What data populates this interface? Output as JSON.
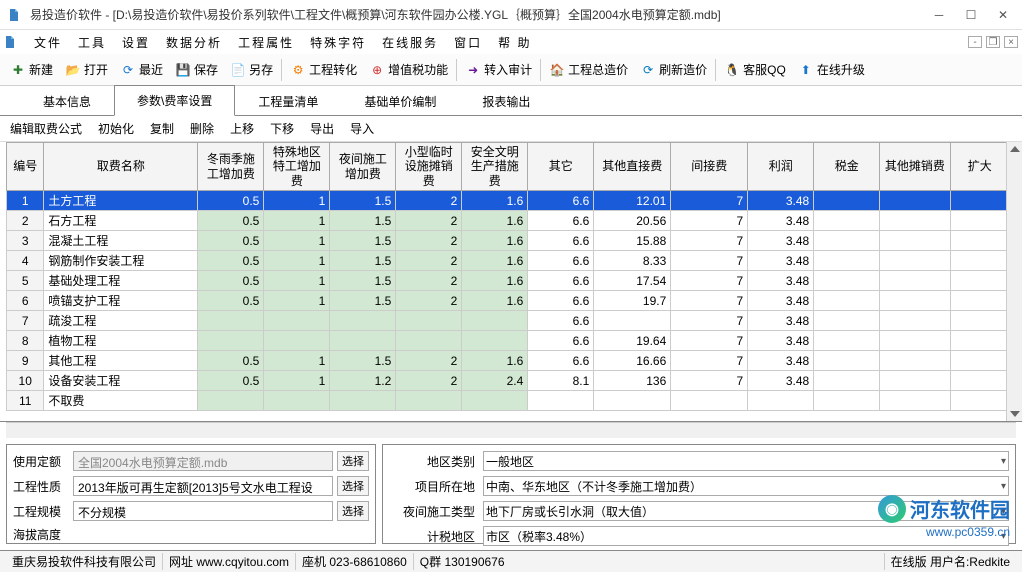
{
  "window": {
    "title": "易投造价软件 - [D:\\易投造价软件\\易投价系列软件\\工程文件\\概预算\\河东软件园办公楼.YGL｛概预算｝全国2004水电预算定额.mdb]"
  },
  "menu": [
    "文件",
    "工具",
    "设置",
    "数据分析",
    "工程属性",
    "特殊字符",
    "在线服务",
    "窗口",
    "帮 助"
  ],
  "toolbar": [
    {
      "icon": "new",
      "label": "新建"
    },
    {
      "icon": "open",
      "label": "打开"
    },
    {
      "icon": "recent",
      "label": "最近"
    },
    {
      "icon": "save",
      "label": "保存"
    },
    {
      "icon": "saveas",
      "label": "另存"
    },
    {
      "sep": true
    },
    {
      "icon": "convert",
      "label": "工程转化"
    },
    {
      "icon": "vat",
      "label": "增值税功能"
    },
    {
      "sep": true
    },
    {
      "icon": "audit",
      "label": "转入审计"
    },
    {
      "sep": true
    },
    {
      "icon": "total",
      "label": "工程总造价"
    },
    {
      "icon": "refresh",
      "label": "刷新造价"
    },
    {
      "sep": true
    },
    {
      "icon": "qq",
      "label": "客服QQ"
    },
    {
      "icon": "upgrade",
      "label": "在线升级"
    }
  ],
  "tabs": [
    "基本信息",
    "参数\\费率设置",
    "工程量清单",
    "基础单价编制",
    "报表输出"
  ],
  "activeTab": 1,
  "subToolbar": [
    "编辑取费公式",
    "初始化",
    "复制",
    "删除",
    "上移",
    "下移",
    "导出",
    "导入"
  ],
  "columns": [
    "编号",
    "取费名称",
    "冬雨季施工增加费",
    "特殊地区特工增加费",
    "夜间施工增加费",
    "小型临时设施摊销费",
    "安全文明生产措施费",
    "其它",
    "其他直接费",
    "间接费",
    "利润",
    "税金",
    "其他摊销费",
    "扩大"
  ],
  "rows": [
    {
      "idx": "1",
      "name": "土方工程",
      "c": [
        "0.5",
        "1",
        "1.5",
        "2",
        "1.6",
        "6.6",
        "12.01",
        "7",
        "3.48",
        "",
        ""
      ],
      "sel": true
    },
    {
      "idx": "2",
      "name": "石方工程",
      "c": [
        "0.5",
        "1",
        "1.5",
        "2",
        "1.6",
        "6.6",
        "20.56",
        "7",
        "3.48",
        "",
        ""
      ]
    },
    {
      "idx": "3",
      "name": "混凝土工程",
      "c": [
        "0.5",
        "1",
        "1.5",
        "2",
        "1.6",
        "6.6",
        "15.88",
        "7",
        "3.48",
        "",
        ""
      ]
    },
    {
      "idx": "4",
      "name": "钢筋制作安装工程",
      "c": [
        "0.5",
        "1",
        "1.5",
        "2",
        "1.6",
        "6.6",
        "8.33",
        "7",
        "3.48",
        "",
        ""
      ]
    },
    {
      "idx": "5",
      "name": "基础处理工程",
      "c": [
        "0.5",
        "1",
        "1.5",
        "2",
        "1.6",
        "6.6",
        "17.54",
        "7",
        "3.48",
        "",
        ""
      ]
    },
    {
      "idx": "6",
      "name": "喷锚支护工程",
      "c": [
        "0.5",
        "1",
        "1.5",
        "2",
        "1.6",
        "6.6",
        "19.7",
        "7",
        "3.48",
        "",
        ""
      ]
    },
    {
      "idx": "7",
      "name": "疏浚工程",
      "c": [
        "",
        "",
        "",
        "",
        "",
        "6.6",
        "",
        "7",
        "3.48",
        "",
        ""
      ]
    },
    {
      "idx": "8",
      "name": "植物工程",
      "c": [
        "",
        "",
        "",
        "",
        "",
        "6.6",
        "19.64",
        "7",
        "3.48",
        "",
        ""
      ]
    },
    {
      "idx": "9",
      "name": "其他工程",
      "c": [
        "0.5",
        "1",
        "1.5",
        "2",
        "1.6",
        "6.6",
        "16.66",
        "7",
        "3.48",
        "",
        ""
      ]
    },
    {
      "idx": "10",
      "name": "设备安装工程",
      "c": [
        "0.5",
        "1",
        "1.2",
        "2",
        "2.4",
        "8.1",
        "136",
        "7",
        "3.48",
        "",
        ""
      ]
    },
    {
      "idx": "11",
      "name": "不取费",
      "c": [
        "",
        "",
        "",
        "",
        "",
        "",
        "",
        "",
        "",
        "",
        ""
      ]
    }
  ],
  "form": {
    "left": {
      "quota_label": "使用定额",
      "quota_value": "全国2004水电预算定额.mdb",
      "select_btn": "选择",
      "nature_label": "工程性质",
      "nature_value": "2013年版可再生定额[2013]5号文水电工程设",
      "scale_label": "工程规模",
      "scale_value": "不分规模",
      "altitude_label": "海拔高度"
    },
    "right": {
      "region_label": "地区类别",
      "region_value": "一般地区",
      "location_label": "项目所在地",
      "location_value": "中南、华东地区（不计冬季施工增加费）",
      "night_label": "夜间施工类型",
      "night_value": "地下厂房或长引水洞（取大值）",
      "tax_label": "计税地区",
      "tax_value": "市区（税率3.48%）"
    }
  },
  "status": {
    "company": "重庆易投软件科技有限公司",
    "website": "网址 www.cqyitou.com",
    "phone": "座机 023-68610860",
    "qq": "Q群   130190676",
    "version": "在线版 用户名:Redkite"
  },
  "watermark": {
    "name": "河东软件园",
    "url": "www.pc0359.cn"
  }
}
